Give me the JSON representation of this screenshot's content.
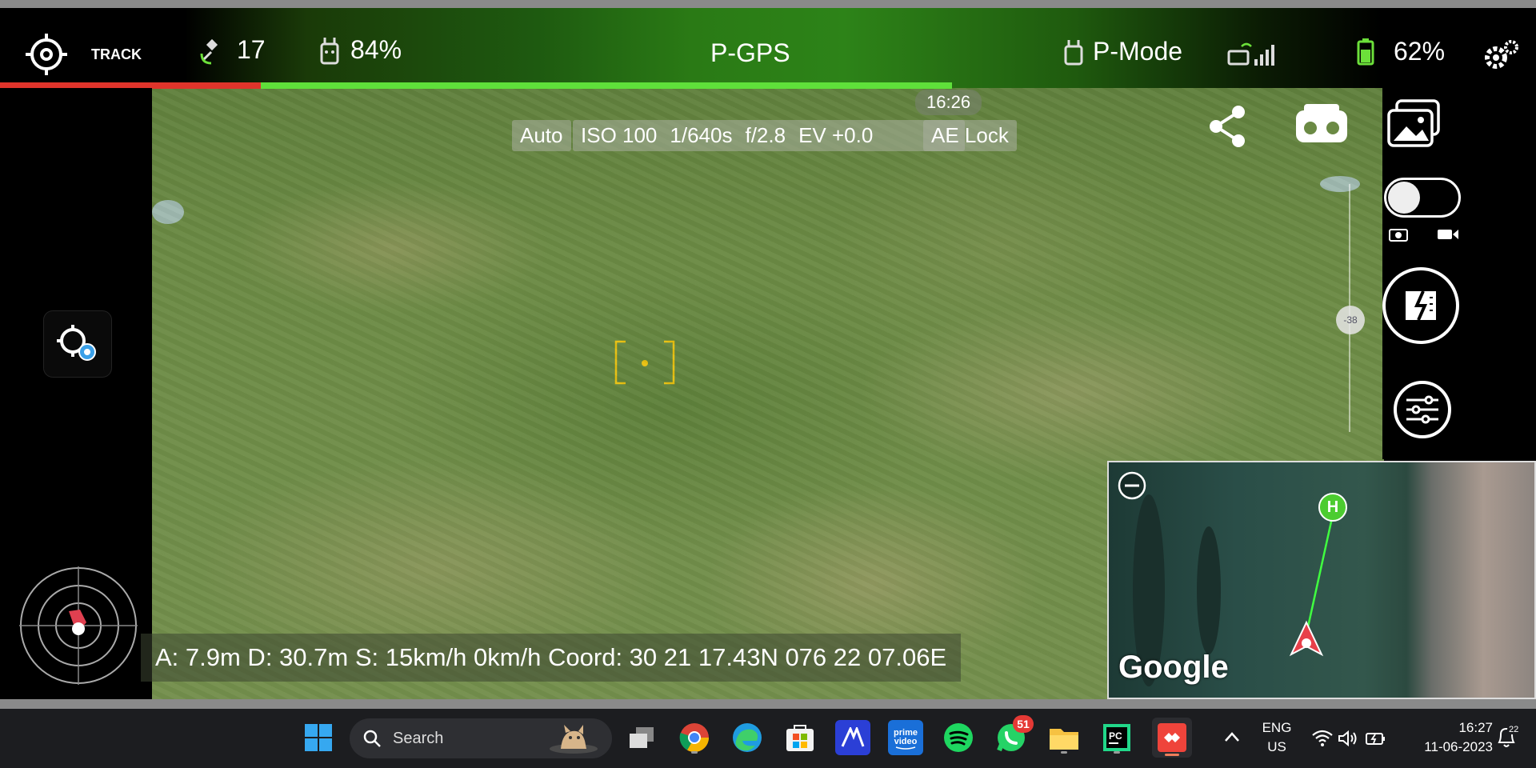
{
  "topbar": {
    "track_label": "TRACK",
    "satellites": "17",
    "rc_battery": "84%",
    "gps_mode": "P-GPS",
    "flight_mode": "P-Mode",
    "drone_battery": "62%",
    "progress_red_fraction": 0.17,
    "progress_green_fraction": 0.45
  },
  "camera": {
    "time": "16:26",
    "mode": "Auto",
    "iso": "ISO 100",
    "shutter": "1/640s",
    "aperture": "f/2.8",
    "ev": "EV +0.0",
    "ae_lock": "AE Lock",
    "gimbal_value": "-38"
  },
  "telemetry": {
    "text": "A: 7.9m D: 30.7m S: 15km/h  0km/h Coord: 30 21 17.43N 076 22 07.06E"
  },
  "minimap": {
    "home_label": "H",
    "provider": "Google"
  },
  "taskbar": {
    "search_placeholder": "Search",
    "whatsapp_badge": "51",
    "lang_line1": "ENG",
    "lang_line2": "US",
    "clock_time": "16:27",
    "clock_date": "11-06-2023",
    "notif_count": "22",
    "apps": [
      "start-icon",
      "task-view-icon",
      "chrome-icon",
      "edge-icon",
      "store-icon",
      "ms-app-icon",
      "prime-video-icon",
      "spotify-icon",
      "whatsapp-icon",
      "file-explorer-icon",
      "pycharm-icon",
      "anydesk-icon"
    ]
  },
  "colors": {
    "accent_green": "#5fe03a",
    "accent_red": "#e0342b",
    "focus_yellow": "#e8c010"
  }
}
